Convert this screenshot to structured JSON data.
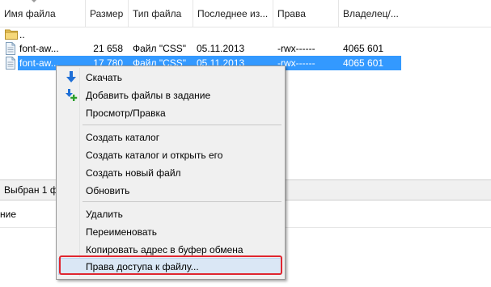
{
  "columns": [
    {
      "label": "Имя файла"
    },
    {
      "label": "Размер"
    },
    {
      "label": "Тип файла"
    },
    {
      "label": "Последнее из..."
    },
    {
      "label": "Права"
    },
    {
      "label": "Владелец/..."
    }
  ],
  "rows": [
    {
      "icon": "folder-icon",
      "name": "..",
      "size": "",
      "type": "",
      "modified": "",
      "perms": "",
      "owner": ""
    },
    {
      "icon": "file-icon",
      "name": "font-aw...",
      "size": "21 658",
      "type": "Файл \"CSS\"",
      "modified": "05.11.2013",
      "perms": "-rwx------",
      "owner": "4065 601"
    },
    {
      "icon": "file-icon",
      "name": "font-aw...",
      "size": "17 780",
      "type": "Файл \"CSS\"",
      "modified": "05.11.2013",
      "perms": "-rwx------",
      "owner": "4065 601",
      "selected": true
    }
  ],
  "status": {
    "text": "Выбран 1 фа"
  },
  "queue": {
    "column_fragment": "ние"
  },
  "context_menu": {
    "items": [
      {
        "label": "Скачать",
        "icon": "download-arrow-icon"
      },
      {
        "label": "Добавить файлы в задание",
        "icon": "add-to-queue-icon"
      },
      {
        "label": "Просмотр/Правка"
      },
      {
        "label": "Создать каталог"
      },
      {
        "label": "Создать каталог и открыть его"
      },
      {
        "label": "Создать новый файл"
      },
      {
        "label": "Обновить"
      },
      {
        "label": "Удалить"
      },
      {
        "label": "Переименовать"
      },
      {
        "label": "Копировать адрес в буфер обмена"
      },
      {
        "label": "Права доступа к файлу..."
      }
    ]
  },
  "colors": {
    "selection": "#3399ff",
    "menu_highlight": "#dae7f5",
    "annotation_box": "#e0262f",
    "download_icon": "#1f6fd6",
    "add_icon_plus": "#2ca02c"
  }
}
